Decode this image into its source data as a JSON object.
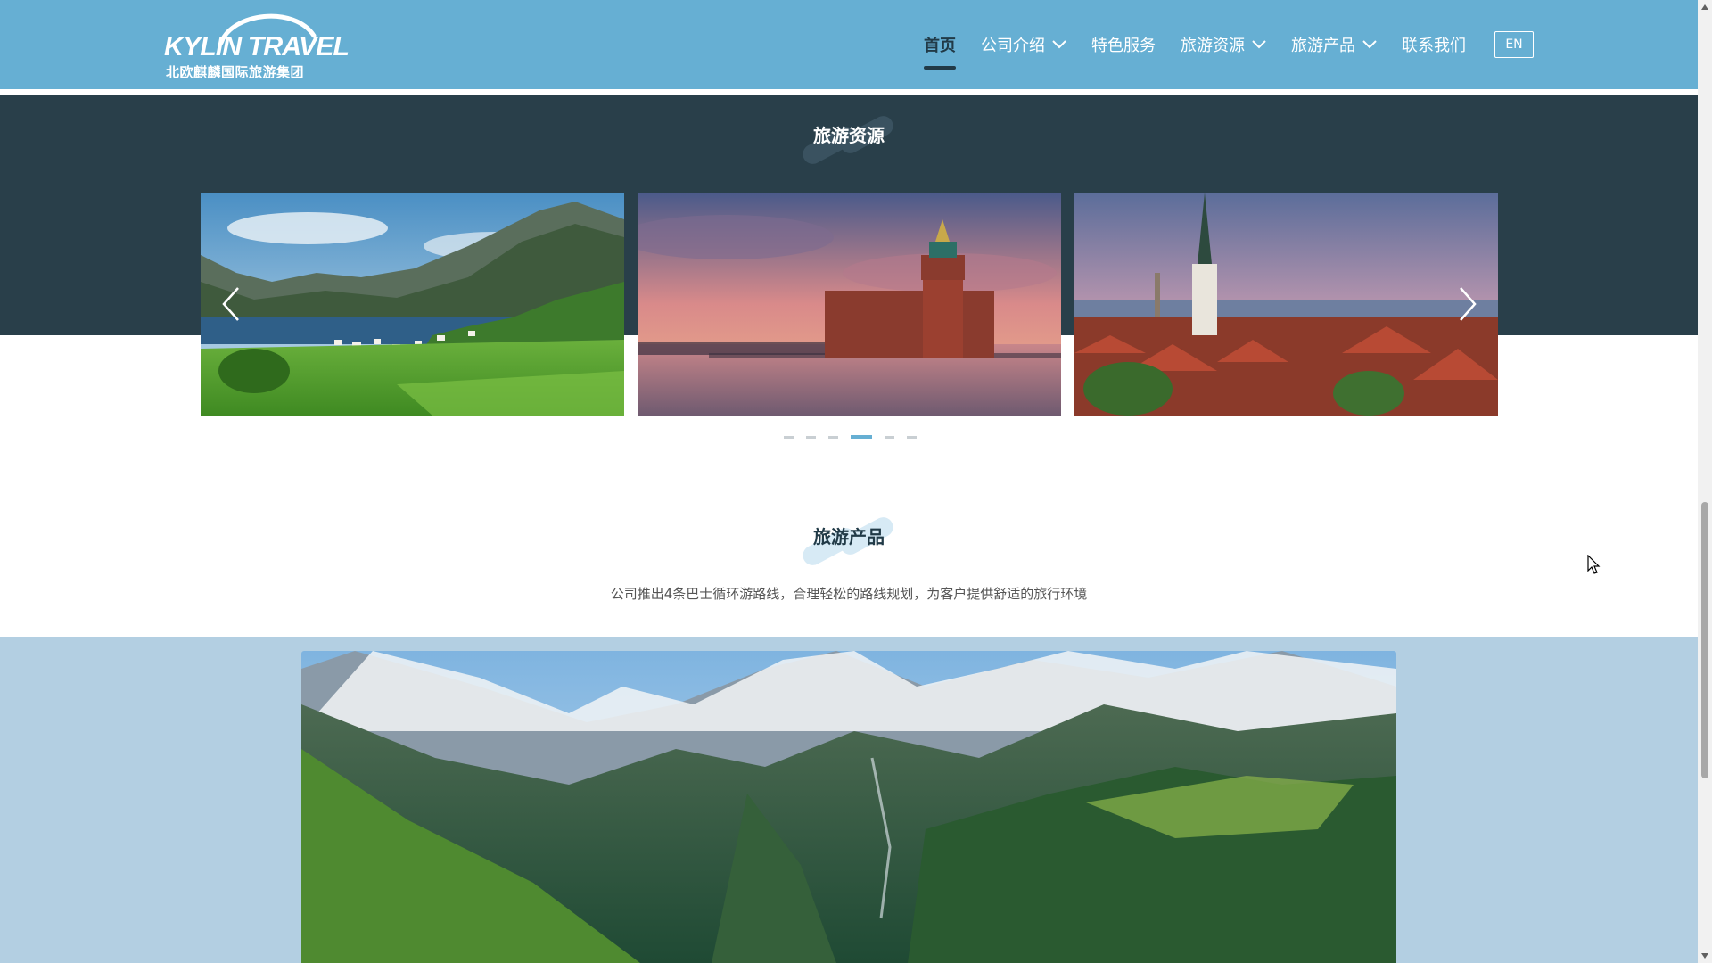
{
  "header": {
    "logo": {
      "text_en": "KYLIN TRAVEL",
      "text_cn": "北欧麒麟国际旅游集团"
    },
    "nav": [
      {
        "label": "首页",
        "active": true,
        "dropdown": false
      },
      {
        "label": "公司介绍",
        "active": false,
        "dropdown": true
      },
      {
        "label": "特色服务",
        "active": false,
        "dropdown": false
      },
      {
        "label": "旅游资源",
        "active": false,
        "dropdown": true
      },
      {
        "label": "旅游产品",
        "active": false,
        "dropdown": true
      },
      {
        "label": "联系我们",
        "active": false,
        "dropdown": false
      }
    ],
    "lang_button": "EN"
  },
  "resources": {
    "title": "旅游资源",
    "slides": [
      {
        "name": "fjord-village"
      },
      {
        "name": "stockholm-city-hall-sunset"
      },
      {
        "name": "tallinn-old-town"
      }
    ],
    "dots_count": 6,
    "active_dot": 3
  },
  "products": {
    "title": "旅游产品",
    "description": "公司推出4条巴士循环游路线，合理轻松的路线规划，为客户提供舒适的旅行环境",
    "hero_image": {
      "name": "geiranger-fjord-mountains"
    }
  },
  "colors": {
    "header_bg": "#66afd3",
    "dark_band": "#293f4a",
    "light_band": "#b3cfe2",
    "accent": "#66afd3",
    "title_dark": "#213a47"
  }
}
